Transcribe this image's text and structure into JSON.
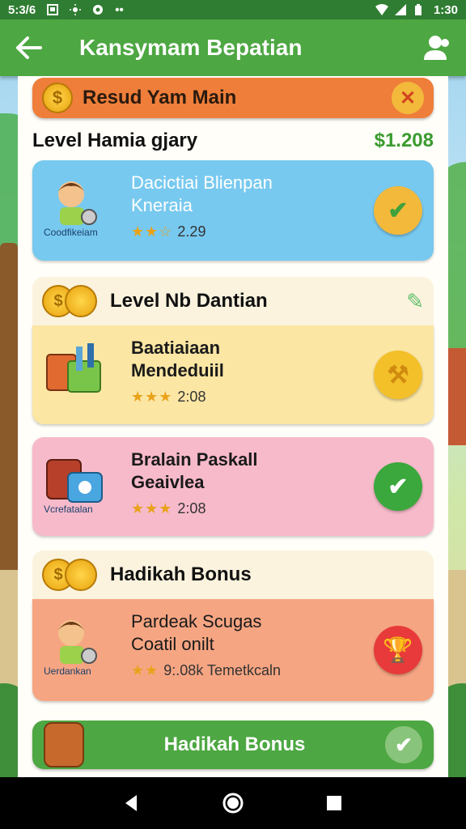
{
  "status_bar": {
    "time_left": "5:3/6",
    "time_right": "1:30"
  },
  "app_bar": {
    "title": "Kansymam Bepatian"
  },
  "header_pill": {
    "label": "Resud Yam Main"
  },
  "level_row": {
    "name": "Level Hamia gjary",
    "amount": "$1.208"
  },
  "cards": [
    {
      "title_line1": "Dacictiai Blienpan",
      "title_line2": "Kneraia",
      "caption": "Coodfikeiam",
      "rating": 2.5,
      "stars": "★★☆",
      "meta": "2.29",
      "action_color": "#f3b93b",
      "bg": "#78c9ef"
    },
    {
      "title_line1": "Baatiaiaan",
      "title_line2": "Mendeduiil",
      "caption": "",
      "stars": "★★★",
      "meta": "2:08",
      "action_color": "#f3c02a",
      "bg": "#fbe6a4"
    },
    {
      "title_line1": "Bralain Paskall",
      "title_line2": "Geaivlea",
      "caption": "Vcrefatalan",
      "stars": "★★★",
      "meta": "2:08",
      "action_color": "#3aa83c",
      "bg": "#f7bacb"
    },
    {
      "title_line1": "Pardeak Scugas",
      "title_line2": "Coatil onilt",
      "caption": "Uerdankan",
      "stars": "★★",
      "meta": "9:.08k Temetkcaln",
      "action_color": "#e83a3a",
      "bg": "#f6a582"
    }
  ],
  "section_1": {
    "title": "Level Nb Dantian"
  },
  "section_2": {
    "title": "Hadikah Bonus"
  },
  "bottom_bar": {
    "label": "Hadikah Bonus"
  },
  "colors": {
    "primary_green": "#4da742",
    "status_green": "#2f7d32",
    "orange": "#ee7e3a"
  }
}
